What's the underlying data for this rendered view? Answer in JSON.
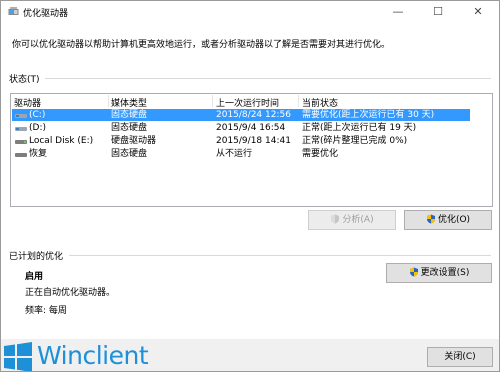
{
  "window": {
    "title": "优化驱动器",
    "minimize_glyph": "—",
    "maximize_glyph": "☐",
    "close_glyph": "✕"
  },
  "description": "你可以优化驱动器以帮助计算机更高效地运行，或者分析驱动器以了解是否需要对其进行优化。",
  "status": {
    "label": "状态(T)",
    "columns": [
      "驱动器",
      "媒体类型",
      "上一次运行时间",
      "当前状态"
    ],
    "rows": [
      {
        "drive": "(C:)",
        "media": "固态硬盘",
        "last_run": "2015/8/24 12:56",
        "state": "需要优化(距上次运行已有 30 天)",
        "selected": true
      },
      {
        "drive": "(D:)",
        "media": "固态硬盘",
        "last_run": "2015/9/4 16:54",
        "state": "正常(距上次运行已有 19 天)",
        "selected": false
      },
      {
        "drive": "Local Disk (E:)",
        "media": "硬盘驱动器",
        "last_run": "2015/9/18 14:41",
        "state": "正常(碎片整理已完成 0%)",
        "selected": false
      },
      {
        "drive": "恢复",
        "media": "固态硬盘",
        "last_run": "从不运行",
        "state": "需要优化",
        "selected": false
      }
    ]
  },
  "buttons": {
    "analyze": "分析(A)",
    "optimize": "优化(O)",
    "change_settings": "更改设置(S)",
    "close": "关闭(C)"
  },
  "scheduled": {
    "label": "已计划的优化",
    "state": "启用",
    "detail": "正在自动优化驱动器。",
    "frequency": "频率: 每周"
  },
  "branding": {
    "name": "Winclient",
    "color": "#1e90d8"
  },
  "colors": {
    "selection": "#3399ff",
    "shield_blue": "#2b63c4",
    "shield_yellow": "#f2c200"
  }
}
